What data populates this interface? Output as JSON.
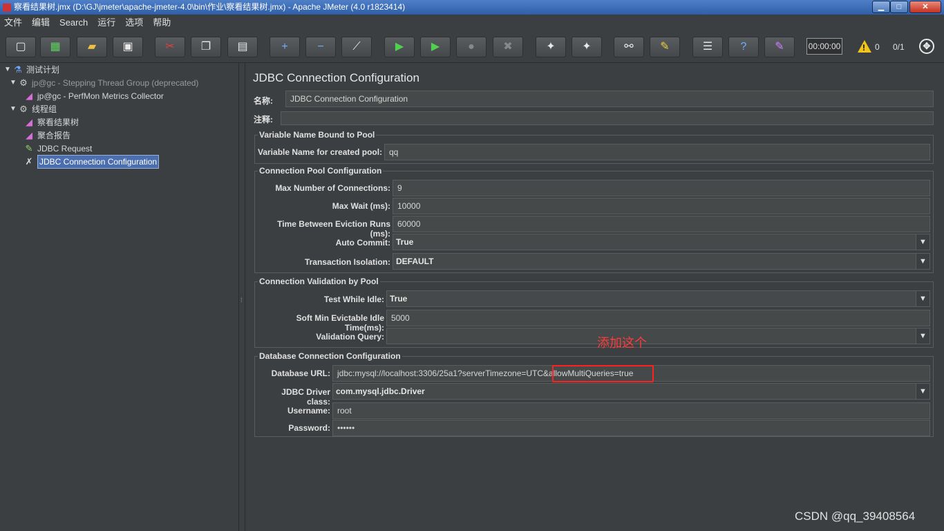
{
  "window": {
    "title": "察看结果树.jmx (D:\\GJ\\jmeter\\apache-jmeter-4.0\\bin\\作业\\察看结果树.jmx) - Apache JMeter (4.0 r1823414)",
    "minimize": "▁",
    "maximize": "□",
    "close": "✕"
  },
  "menu": [
    "文件",
    "编辑",
    "Search",
    "运行",
    "选项",
    "帮助"
  ],
  "toolbar": {
    "buttons": [
      {
        "name": "new-icon",
        "glyph": "▢"
      },
      {
        "name": "templates-icon",
        "glyph": "▦"
      },
      {
        "name": "open-icon",
        "glyph": "▰"
      },
      {
        "name": "save-icon",
        "glyph": "▣"
      },
      {
        "name": "cut-icon",
        "glyph": "✂"
      },
      {
        "name": "copy-icon",
        "glyph": "❐"
      },
      {
        "name": "paste-icon",
        "glyph": "▤"
      },
      {
        "name": "expand-icon",
        "glyph": "+"
      },
      {
        "name": "collapse-icon",
        "glyph": "−"
      },
      {
        "name": "toggle-icon",
        "glyph": "⟋"
      },
      {
        "name": "start-icon",
        "glyph": "▶"
      },
      {
        "name": "start-no-pause-icon",
        "glyph": "▶"
      },
      {
        "name": "stop-icon",
        "glyph": "●"
      },
      {
        "name": "shutdown-icon",
        "glyph": "✖"
      },
      {
        "name": "clear-icon",
        "glyph": "✦"
      },
      {
        "name": "clear-all-icon",
        "glyph": "✦"
      },
      {
        "name": "search-icon",
        "glyph": "⚯"
      },
      {
        "name": "reset-search-icon",
        "glyph": "✎"
      },
      {
        "name": "function-helper-icon",
        "glyph": "☰"
      },
      {
        "name": "help-icon",
        "glyph": "?"
      },
      {
        "name": "logger-icon",
        "glyph": "✎"
      }
    ],
    "timer": "00:00:00",
    "warn_count": "0",
    "threads": "0/1",
    "remote_glyph": "✥"
  },
  "tree": [
    {
      "label": "测试计划",
      "icon": "flask-icon",
      "glyph": "⚗",
      "arrow": "▼",
      "indent": 0,
      "dim": false,
      "selected": false
    },
    {
      "label": "jp@gc - Stepping Thread Group (deprecated)",
      "icon": "gear-icon",
      "glyph": "⚙",
      "arrow": "▼",
      "indent": 1,
      "dim": true,
      "selected": false
    },
    {
      "label": "jp@gc - PerfMon Metrics Collector",
      "icon": "chart-icon",
      "glyph": "◢",
      "arrow": "",
      "indent": 2,
      "dim": false,
      "selected": false
    },
    {
      "label": "线程组",
      "icon": "gear-icon",
      "glyph": "⚙",
      "arrow": "▼",
      "indent": 1,
      "dim": false,
      "selected": false
    },
    {
      "label": "察看结果树",
      "icon": "chart-icon",
      "glyph": "◢",
      "arrow": "",
      "indent": 2,
      "dim": false,
      "selected": false
    },
    {
      "label": "聚合报告",
      "icon": "chart-icon",
      "glyph": "◢",
      "arrow": "",
      "indent": 2,
      "dim": false,
      "selected": false
    },
    {
      "label": "JDBC Request",
      "icon": "pen-icon",
      "glyph": "✎",
      "arrow": "",
      "indent": 2,
      "dim": false,
      "selected": false
    },
    {
      "label": "JDBC Connection Configuration",
      "icon": "tools-icon",
      "glyph": "✗",
      "arrow": "",
      "indent": 2,
      "dim": false,
      "selected": true
    }
  ],
  "panel": {
    "title": "JDBC Connection Configuration",
    "name_label": "名称:",
    "name_value": "JDBC Connection Configuration",
    "comment_label": "注释:",
    "comment_value": "",
    "var_group": {
      "title": "Variable Name Bound to Pool",
      "var_label": "Variable Name for created pool:",
      "var_value": "qq"
    },
    "pool_group": {
      "title": "Connection Pool Configuration",
      "max_conn_label": "Max Number of Connections:",
      "max_conn_value": "9",
      "max_wait_label": "Max Wait (ms):",
      "max_wait_value": "10000",
      "eviction_label": "Time Between Eviction Runs (ms):",
      "eviction_value": "60000",
      "auto_commit_label": "Auto Commit:",
      "auto_commit_value": "True",
      "isolation_label": "Transaction Isolation:",
      "isolation_value": "DEFAULT"
    },
    "validation_group": {
      "title": "Connection Validation by Pool",
      "test_idle_label": "Test While Idle:",
      "test_idle_value": "True",
      "soft_min_label": "Soft Min Evictable Idle Time(ms):",
      "soft_min_value": "5000",
      "query_label": "Validation Query:",
      "query_value": ""
    },
    "db_group": {
      "title": "Database Connection Configuration",
      "url_label": "Database URL:",
      "url_value": "jdbc:mysql://localhost:3306/25a1?serverTimezone=UTC&allowMultiQueries=true",
      "driver_label": "JDBC Driver class:",
      "driver_value": "com.mysql.jdbc.Driver",
      "username_label": "Username:",
      "username_value": "root",
      "password_label": "Password:",
      "password_value": "••••••"
    },
    "dropdown_glyph": "▼"
  },
  "annotation": "添加这个",
  "watermark": "CSDN @qq_39408564"
}
